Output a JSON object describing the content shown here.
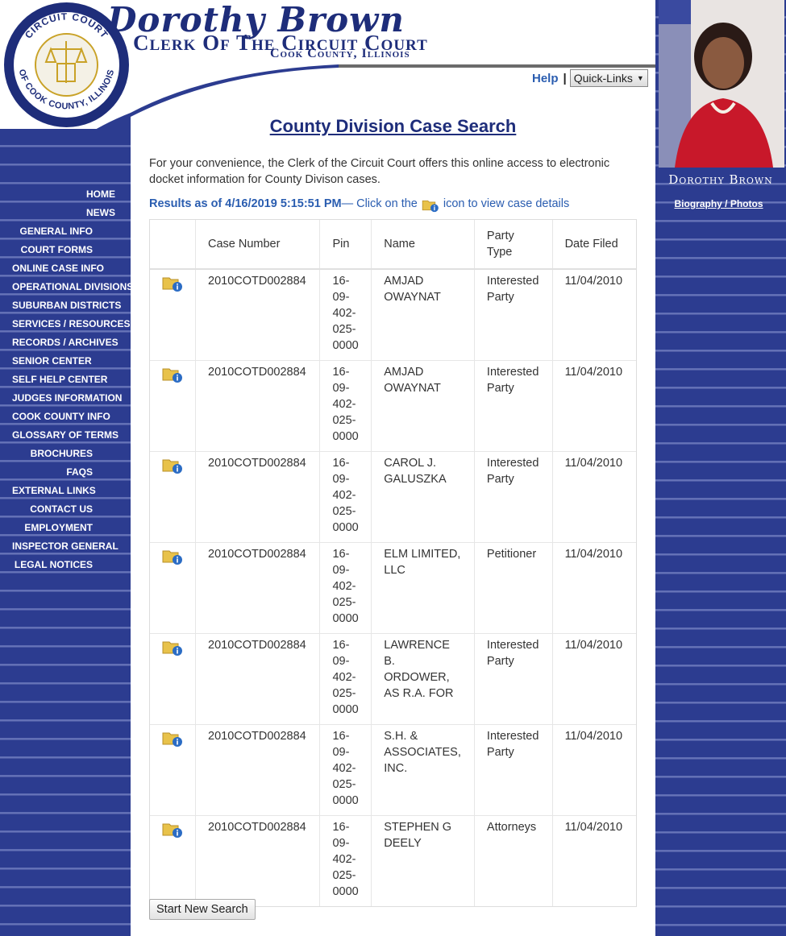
{
  "header": {
    "name": "Dorothy Brown",
    "office": "Clerk Of The Circuit Court",
    "county": "Cook County, Illinois",
    "seal_top_text": "CIRCUIT COURT",
    "seal_bottom_text": "OF COOK COUNTY, ILLINOIS"
  },
  "topbar": {
    "help_label": "Help",
    "separator": "|",
    "quick_links_label": "Quick-Links"
  },
  "nav": [
    {
      "label": "HOME",
      "align": "right"
    },
    {
      "label": "NEWS",
      "align": "right"
    },
    {
      "label": "GENERAL INFO",
      "align": "right"
    },
    {
      "label": "COURT FORMS",
      "align": "right"
    },
    {
      "label": "ONLINE CASE INFO",
      "align": "left"
    },
    {
      "label": "OPERATIONAL DIVISIONS",
      "align": "left"
    },
    {
      "label": "SUBURBAN DISTRICTS",
      "align": "left"
    },
    {
      "label": "SERVICES / RESOURCES",
      "align": "left"
    },
    {
      "label": "RECORDS / ARCHIVES",
      "align": "left"
    },
    {
      "label": "SENIOR CENTER",
      "align": "left"
    },
    {
      "label": "SELF HELP CENTER",
      "align": "left"
    },
    {
      "label": "JUDGES INFORMATION",
      "align": "left"
    },
    {
      "label": "COOK COUNTY INFO",
      "align": "left"
    },
    {
      "label": "GLOSSARY OF TERMS",
      "align": "left"
    },
    {
      "label": "BROCHURES",
      "align": "right"
    },
    {
      "label": "FAQS",
      "align": "right"
    },
    {
      "label": "EXTERNAL LINKS",
      "align": "left"
    },
    {
      "label": "CONTACT US",
      "align": "right"
    },
    {
      "label": "EMPLOYMENT",
      "align": "right"
    },
    {
      "label": "INSPECTOR GENERAL",
      "align": "left"
    },
    {
      "label": "LEGAL NOTICES",
      "align": "right"
    }
  ],
  "sidebar_right": {
    "signature": "Dorothy Brown",
    "bio_link": "Biography / Photos"
  },
  "main": {
    "title": "County Division Case Search",
    "intro": "For your convenience, the Clerk of the Circuit Court offers this online access to electronic docket information for County Divison cases.",
    "results_prefix": "Results as of 4/16/2019 5:15:51 PM",
    "results_middle": " — Click on the ",
    "results_suffix": " icon to view case details",
    "start_new_search": "Start New Search"
  },
  "table": {
    "headers": [
      "",
      "Case Number",
      "Pin",
      "Name",
      "Party Type",
      "Date Filed"
    ],
    "rows": [
      {
        "case_number": "2010COTD002884",
        "pin": "16-09-402-025-0000",
        "name": "AMJAD OWAYNAT",
        "party_type": "Interested Party",
        "date_filed": "11/04/2010"
      },
      {
        "case_number": "2010COTD002884",
        "pin": "16-09-402-025-0000",
        "name": "AMJAD OWAYNAT",
        "party_type": "Interested Party",
        "date_filed": "11/04/2010"
      },
      {
        "case_number": "2010COTD002884",
        "pin": "16-09-402-025-0000",
        "name": "CAROL J. GALUSZKA",
        "party_type": "Interested Party",
        "date_filed": "11/04/2010"
      },
      {
        "case_number": "2010COTD002884",
        "pin": "16-09-402-025-0000",
        "name": "ELM LIMITED, LLC",
        "party_type": "Petitioner",
        "date_filed": "11/04/2010"
      },
      {
        "case_number": "2010COTD002884",
        "pin": "16-09-402-025-0000",
        "name": "LAWRENCE B. ORDOWER, AS R.A. FOR",
        "party_type": "Interested Party",
        "date_filed": "11/04/2010"
      },
      {
        "case_number": "2010COTD002884",
        "pin": "16-09-402-025-0000",
        "name": "S.H. & ASSOCIATES, INC.",
        "party_type": "Interested Party",
        "date_filed": "11/04/2010"
      },
      {
        "case_number": "2010COTD002884",
        "pin": "16-09-402-025-0000",
        "name": "STEPHEN G DEELY",
        "party_type": "Attorneys",
        "date_filed": "11/04/2010"
      }
    ]
  },
  "colors": {
    "brand_navy": "#1e2d7a",
    "link_blue": "#2a5db0",
    "stripe_blue": "#2c3c90",
    "folder_yellow": "#e8c24a",
    "info_blue": "#2b6cc4"
  },
  "icons": {
    "detail_icon": "case-details-folder-icon",
    "dropdown_icon": "caret-down-icon"
  }
}
